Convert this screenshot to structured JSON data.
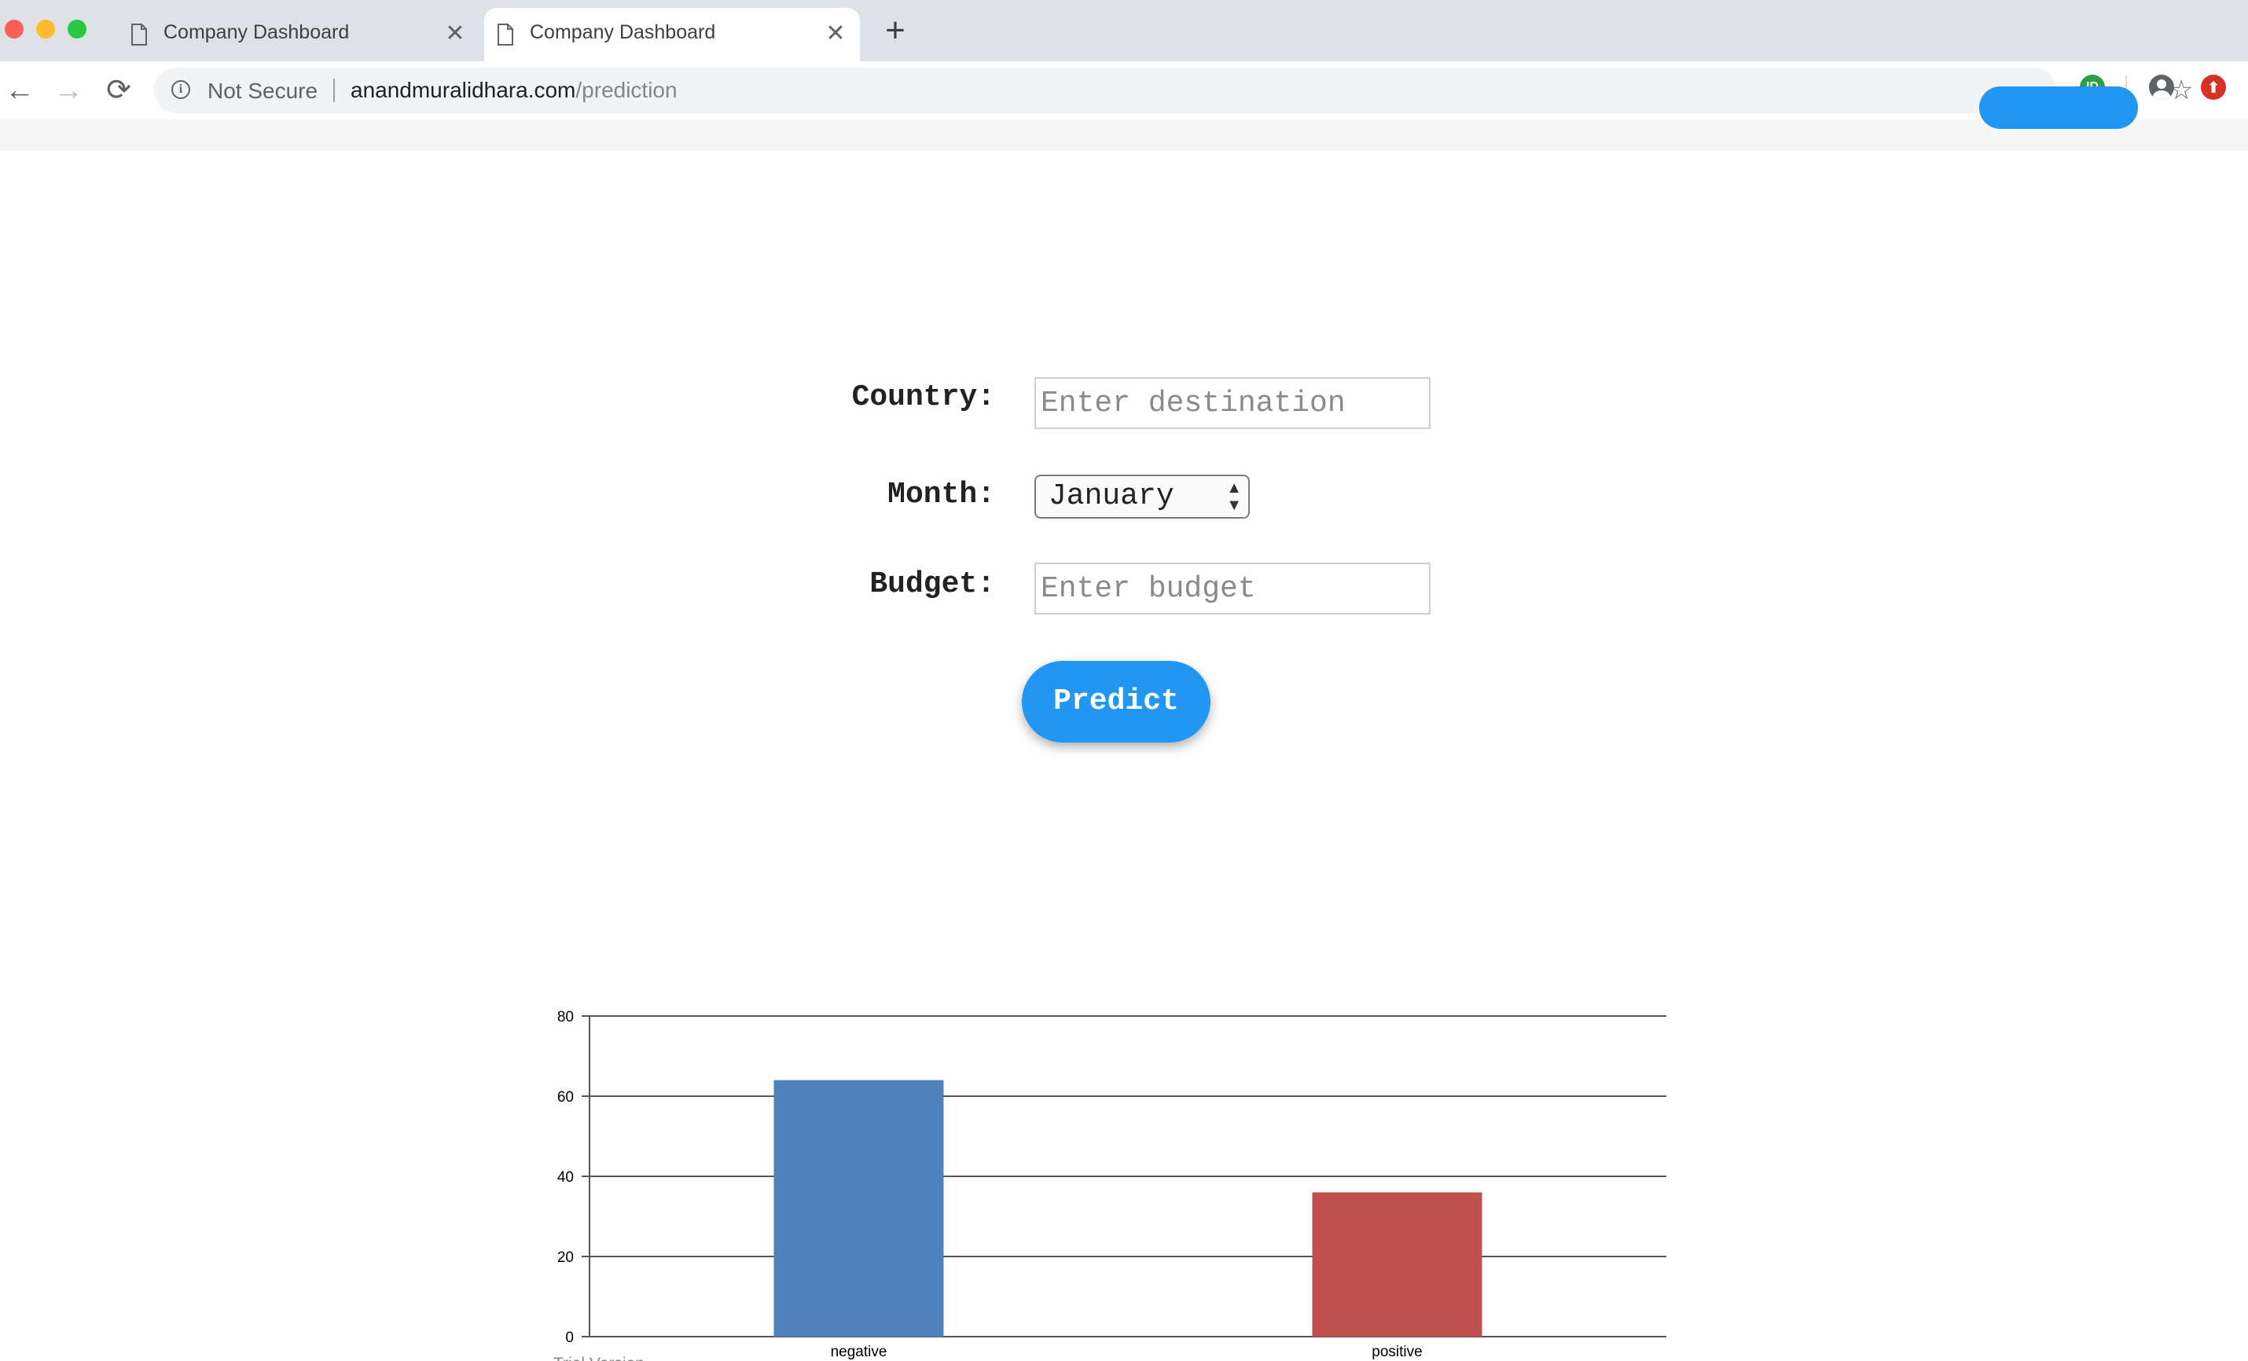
{
  "browser": {
    "tabs": [
      {
        "title": "Company Dashboard",
        "close": "✕",
        "active": false
      },
      {
        "title": "Company Dashboard",
        "close": "✕",
        "active": true
      }
    ],
    "new_tab": "+",
    "security": "Not Secure",
    "url_host": "anandmuralidhara.com",
    "url_path": "/prediction",
    "nav": {
      "back": "←",
      "forward": "→",
      "reload": "⟳"
    },
    "star": "☆",
    "extension_label": "ID",
    "update_glyph": "⬆",
    "colors": {
      "close": "#fe5f57",
      "minimize": "#febc2e",
      "zoom": "#28c840"
    }
  },
  "form": {
    "country_label": "Country:",
    "country_placeholder": "Enter destination",
    "month_label": "Month:",
    "month_value": "January",
    "budget_label": "Budget:",
    "budget_placeholder": "Enter budget",
    "predict_label": "Predict",
    "accent": "#2196f3"
  },
  "chart_data": {
    "type": "bar",
    "categories": [
      "negative",
      "positive"
    ],
    "values": [
      64,
      36
    ],
    "colors": [
      "#4f81bd",
      "#c0504d"
    ],
    "ylim": [
      0,
      80
    ],
    "yticks": [
      0,
      20,
      40,
      60,
      80
    ],
    "grid": true,
    "footer_left": "Trial Version"
  }
}
